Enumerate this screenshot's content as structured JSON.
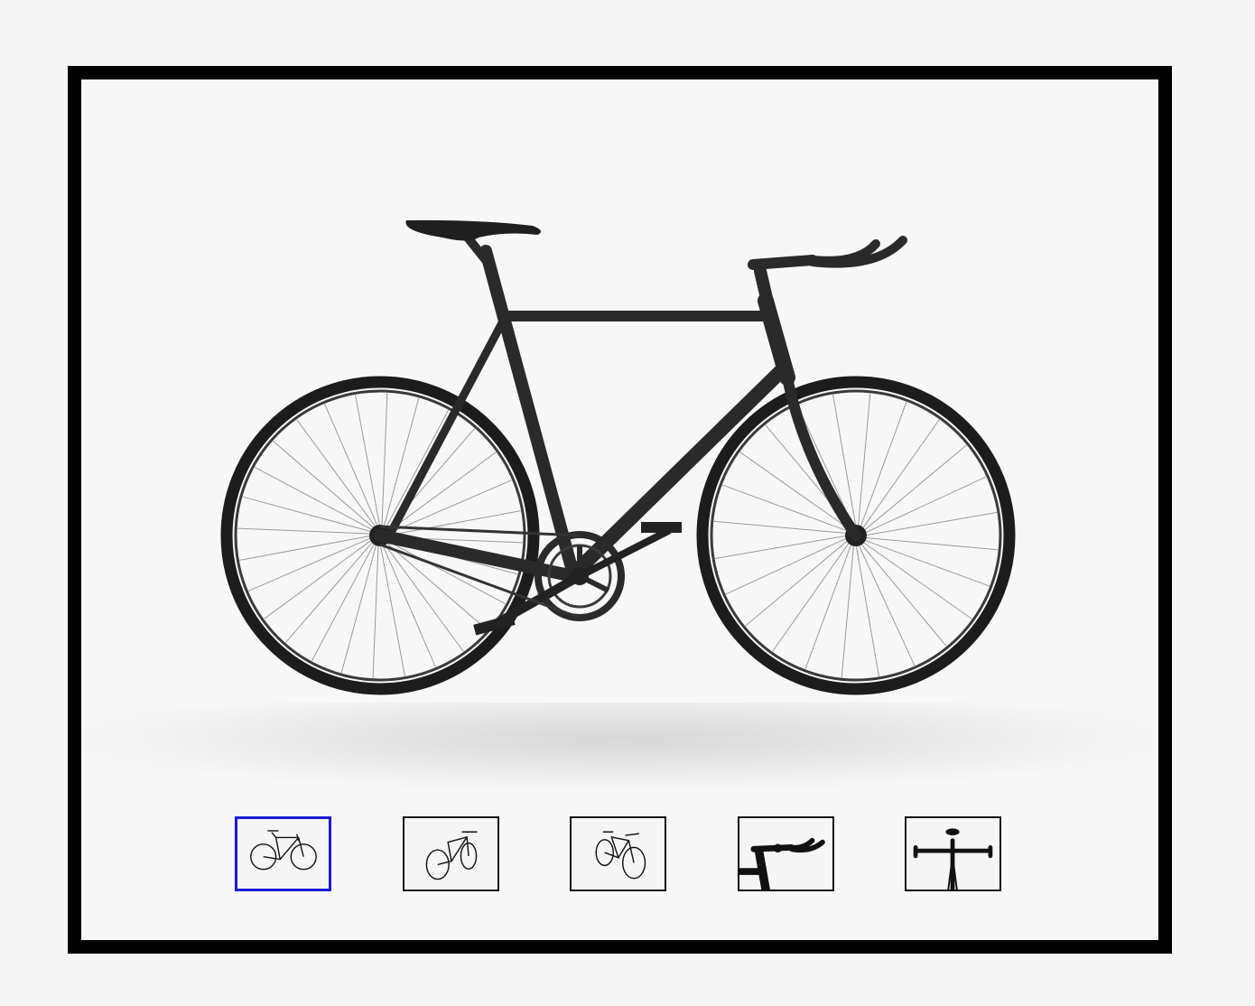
{
  "viewer": {
    "main_view": "bike-side-view",
    "selected_thumbnail": 0,
    "active_border_color": "#1a1ad6",
    "frame_color": "#000000",
    "bike_color": "#2a2a2a"
  },
  "thumbnails": [
    {
      "view": "side"
    },
    {
      "view": "front-three-quarter"
    },
    {
      "view": "rear-three-quarter"
    },
    {
      "view": "handlebar-closeup"
    },
    {
      "view": "front-handlebar"
    }
  ]
}
